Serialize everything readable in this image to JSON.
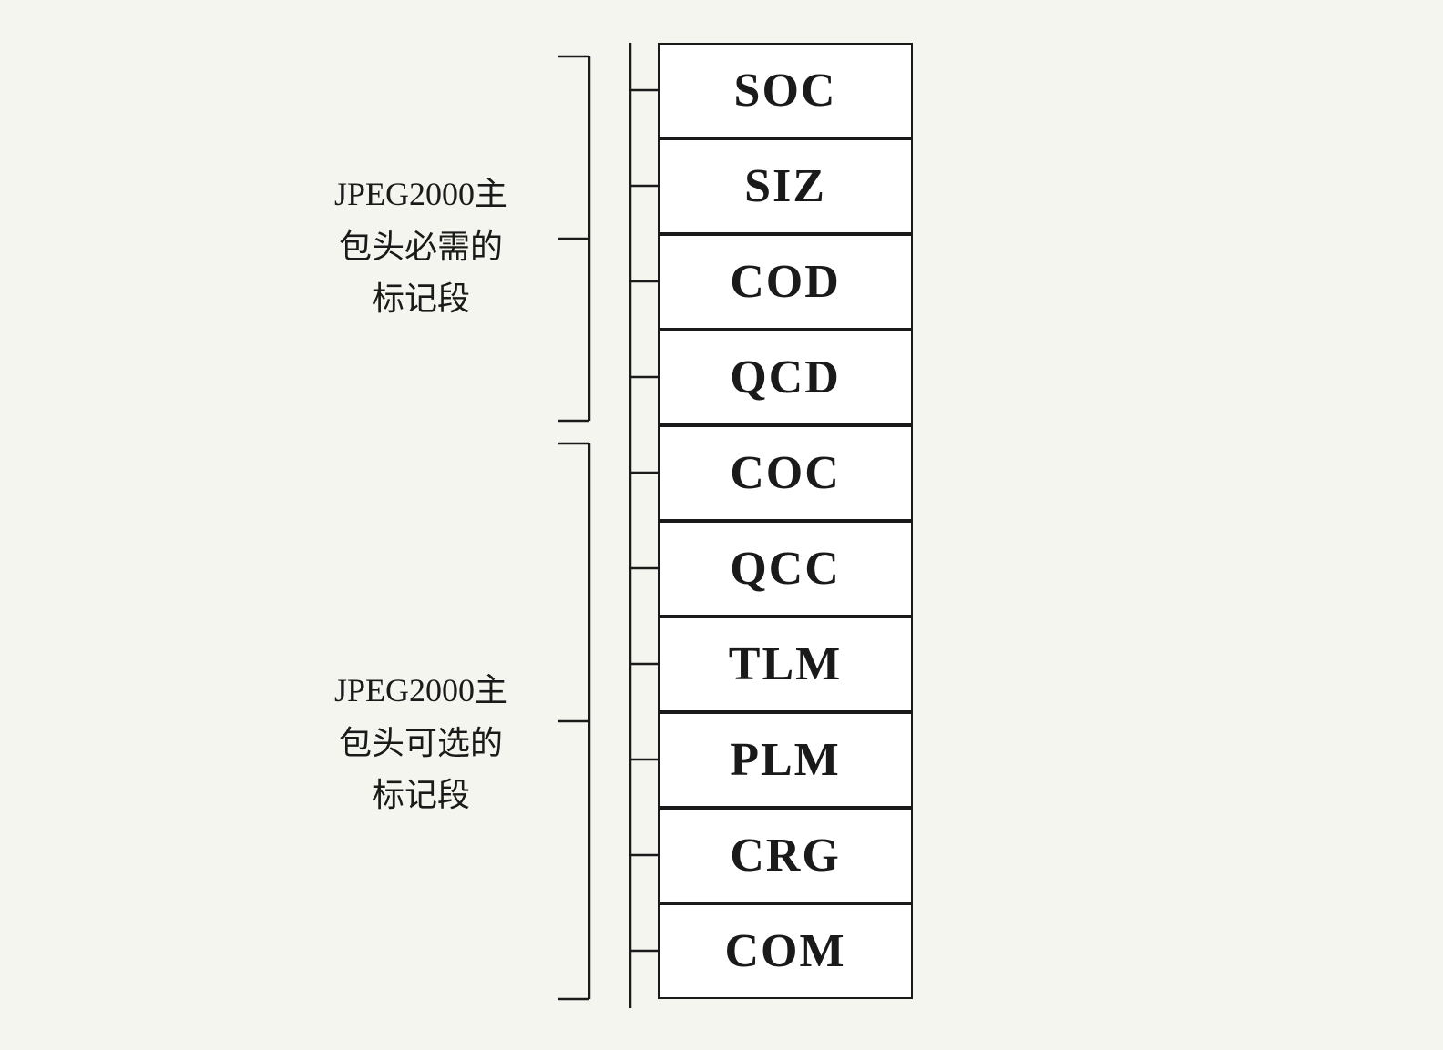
{
  "labels": {
    "required_line1": "JPEG2000主",
    "required_line2": "包头必需的",
    "required_line3": "标记段",
    "optional_line1": "JPEG2000主",
    "optional_line2": "包头可选的",
    "optional_line3": "标记段"
  },
  "required_markers": [
    "SOC",
    "SIZ",
    "COD",
    "QCD"
  ],
  "optional_markers": [
    "COC",
    "QCC",
    "TLM",
    "PLM",
    "CRG",
    "COM"
  ],
  "colors": {
    "border": "#1a1a1a",
    "background": "#f5f5f0",
    "box_bg": "#ffffff",
    "text": "#1a1a1a"
  }
}
